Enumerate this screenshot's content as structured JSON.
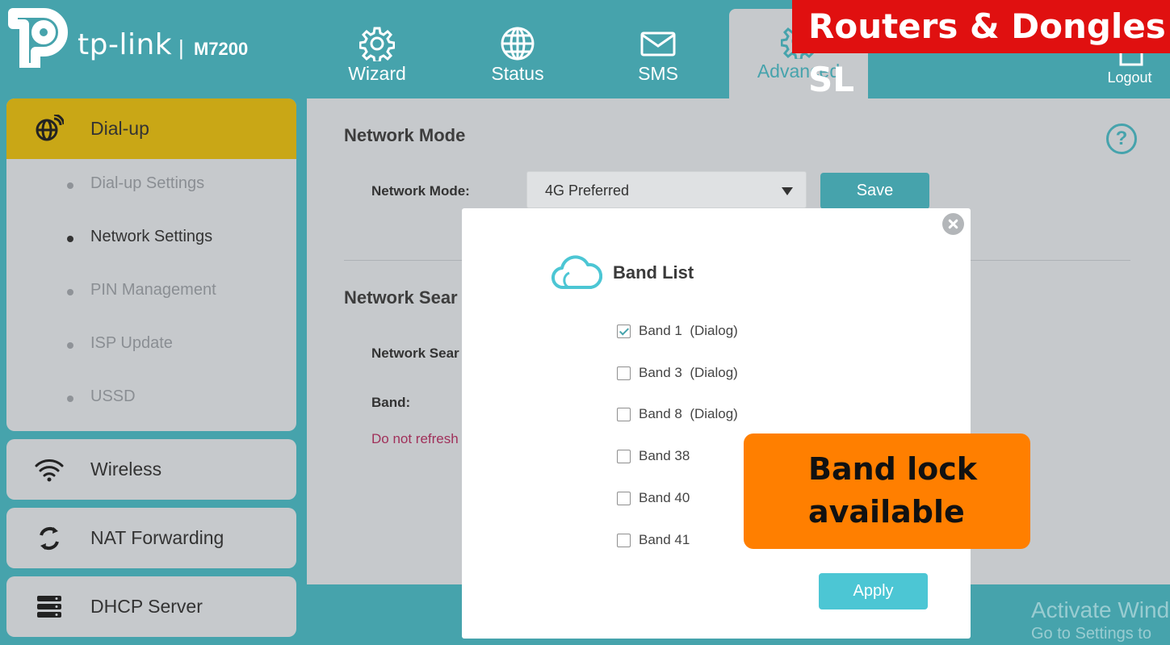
{
  "header": {
    "brand": "tp-link",
    "separator": "|",
    "model": "M7200",
    "tabs": [
      {
        "label": "Wizard",
        "icon": "gear-icon"
      },
      {
        "label": "Status",
        "icon": "globe-icon"
      },
      {
        "label": "SMS",
        "icon": "envelope-icon"
      },
      {
        "label": "Advanced",
        "icon": "gear-icon",
        "active": true
      }
    ],
    "logout": "Logout"
  },
  "banner": "Routers & Dongles SL",
  "sidebar": {
    "groups": [
      {
        "label": "Dial-up",
        "icon": "globe-signal-icon",
        "active": true,
        "items": [
          {
            "label": "Dial-up Settings"
          },
          {
            "label": "Network Settings",
            "active": true
          },
          {
            "label": "PIN Management"
          },
          {
            "label": "ISP Update"
          },
          {
            "label": "USSD"
          }
        ]
      },
      {
        "label": "Wireless",
        "icon": "wifi-icon"
      },
      {
        "label": "NAT Forwarding",
        "icon": "refresh-icon"
      },
      {
        "label": "DHCP Server",
        "icon": "server-icon"
      }
    ]
  },
  "main": {
    "network_mode_title": "Network Mode",
    "network_mode_label": "Network Mode:",
    "network_mode_value": "4G Preferred",
    "save": "Save",
    "network_search_title": "Network Sear",
    "network_search_label": "Network Sear",
    "band_label": "Band:",
    "warning": "Do not refresh",
    "help": "?"
  },
  "modal": {
    "title": "Band List",
    "bands": [
      {
        "label": "Band 1  (Dialog)",
        "checked": true
      },
      {
        "label": "Band 3  (Dialog)",
        "checked": false
      },
      {
        "label": "Band 8  (Dialog)",
        "checked": false
      },
      {
        "label": "Band 38",
        "checked": false
      },
      {
        "label": "Band 40",
        "checked": false
      },
      {
        "label": "Band 41",
        "checked": false
      }
    ],
    "apply": "Apply"
  },
  "callout": {
    "line1": "Band lock",
    "line2": "available"
  },
  "watermark": {
    "line1": "Activate Wind",
    "line2": "Go to Settings to"
  },
  "colors": {
    "teal": "#46a3ac",
    "sidebar_active": "#c9a716",
    "banner": "#e01010",
    "callout": "#ff7f00",
    "apply": "#4cc6d4"
  }
}
